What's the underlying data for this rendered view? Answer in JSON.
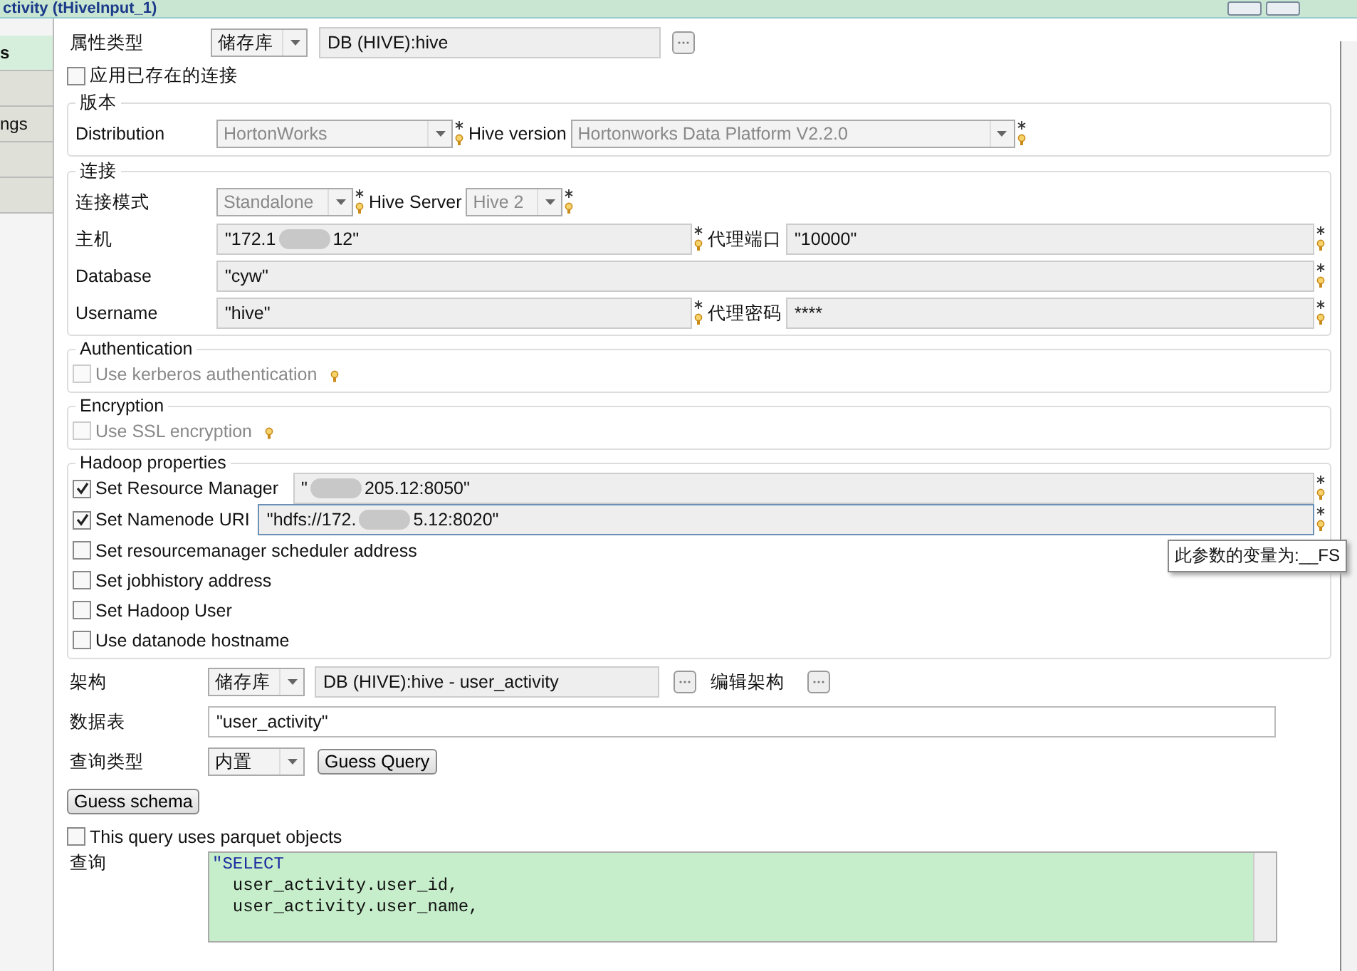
{
  "window": {
    "title": "ctivity  (tHiveInput_1)"
  },
  "side_tabs": [
    {
      "label": "s",
      "selected": true
    },
    {
      "selected": false
    },
    {
      "label": "ngs",
      "selected": false
    },
    {
      "selected": false
    },
    {
      "selected": false
    }
  ],
  "property_type": {
    "label": "属性类型",
    "mode": "储存库",
    "value": "DB (HIVE):hive"
  },
  "use_existing_connection": {
    "label": "应用已存在的连接",
    "checked": false
  },
  "version": {
    "title": "版本",
    "distribution_label": "Distribution",
    "distribution": "HortonWorks",
    "hive_version_label": "Hive version",
    "hive_version": "Hortonworks Data Platform V2.2.0"
  },
  "connection": {
    "title": "连接",
    "mode_label": "连接模式",
    "mode": "Standalone",
    "server_label": "Hive Server",
    "server": "Hive 2",
    "host_label": "主机",
    "host": [
      "\"172.1",
      "12\""
    ],
    "port_label": "代理端口",
    "port": "\"10000\"",
    "db_label": "Database",
    "db": "\"cyw\"",
    "user_label": "Username",
    "user": "\"hive\"",
    "password_label": "代理密码",
    "password": "****"
  },
  "authentication": {
    "title": "Authentication",
    "option": {
      "label": "Use kerberos authentication",
      "checked": false,
      "disabled": true
    }
  },
  "encryption": {
    "title": "Encryption",
    "option": {
      "label": "Use SSL encryption",
      "checked": false,
      "disabled": true
    }
  },
  "hadoop": {
    "title": "Hadoop properties",
    "options": [
      {
        "label": "Set Resource Manager",
        "checked": true,
        "value": [
          "\"",
          "205.12:8050\""
        ],
        "focused": false
      },
      {
        "label": "Set Namenode URI",
        "checked": true,
        "value": [
          "\"hdfs://172.",
          "5.12:8020\""
        ],
        "focused": true
      },
      {
        "label": "Set resourcemanager scheduler address",
        "checked": false
      },
      {
        "label": "Set jobhistory address",
        "checked": false
      },
      {
        "label": "Set Hadoop User",
        "checked": false
      },
      {
        "label": "Use datanode hostname",
        "checked": false
      }
    ]
  },
  "tooltip": "此参数的变量为:__FS",
  "schema": {
    "label": "架构",
    "mode": "储存库",
    "value": "DB (HIVE):hive - user_activity",
    "edit_label": "编辑架构"
  },
  "table": {
    "label": "数据表",
    "value": "\"user_activity\""
  },
  "query_type": {
    "label": "查询类型",
    "mode": "内置",
    "button": "Guess Query"
  },
  "guess_schema": "Guess schema",
  "parquet": {
    "label": "This query uses parquet objects",
    "checked": false
  },
  "query": {
    "label": "查询",
    "lines": [
      "\"SELECT",
      "  user_activity.user_id,",
      "  user_activity.user_name,"
    ]
  }
}
